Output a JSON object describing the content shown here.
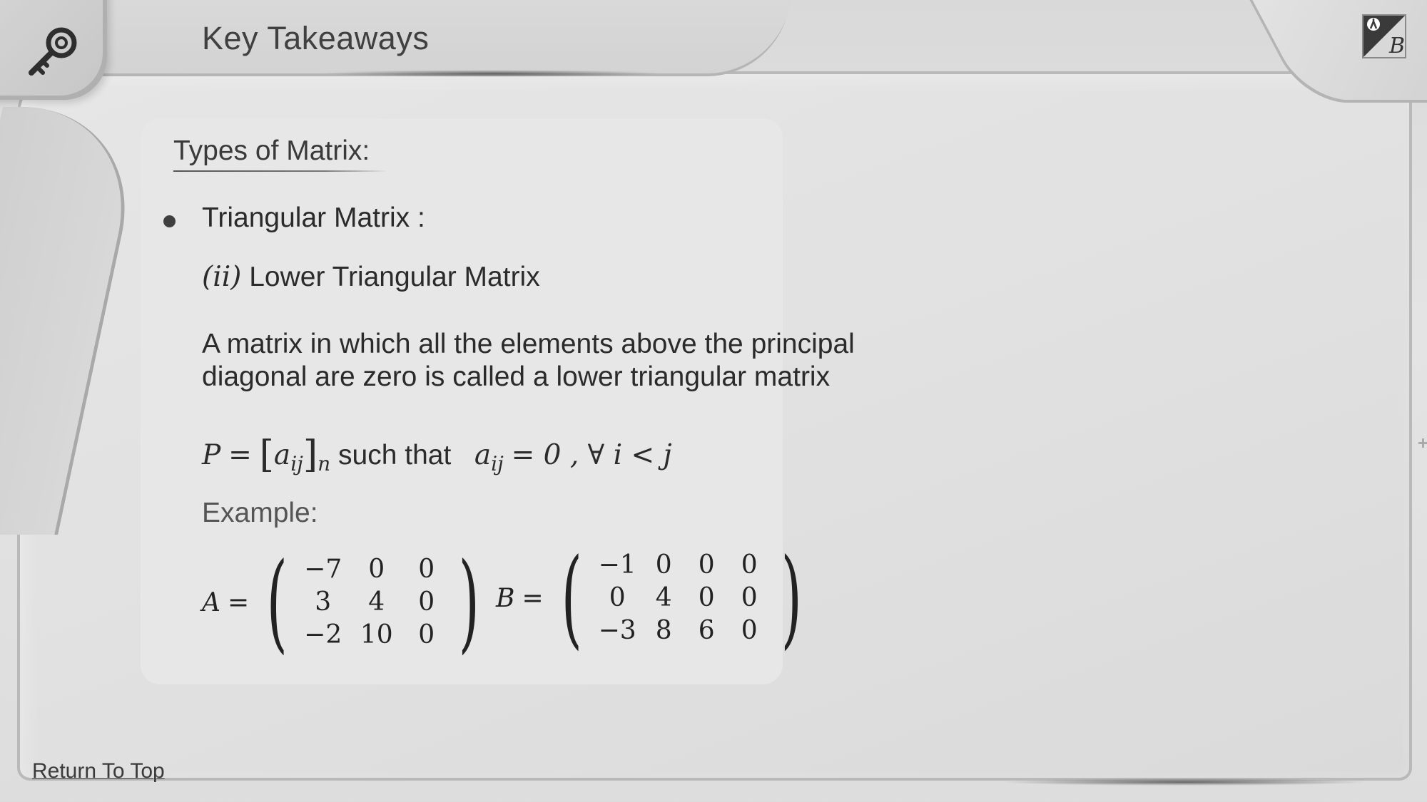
{
  "header": {
    "title": "Key Takeaways",
    "key_icon": "key-icon",
    "corner_icon": "bookmark-b-icon"
  },
  "content": {
    "section_title": "Types of Matrix:",
    "bullet_label": "Triangular Matrix :",
    "subhead_roman": "(ii)",
    "subhead_text": "Lower Triangular Matrix",
    "description_line1": "A matrix in which all the elements above the principal",
    "description_line2": "diagonal are zero is called a lower triangular matrix",
    "formula": {
      "lhs": "P",
      "eq": "=",
      "element": "a",
      "element_sub": "ij",
      "order_sub": "n",
      "connector": "such that",
      "condition_element": "a",
      "condition_sub": "ij",
      "condition_rest": "= 0 , ∀ i < j"
    },
    "example_label": "Example:",
    "matrix_a": {
      "name": "A",
      "rows": [
        [
          "−7",
          "0",
          "0"
        ],
        [
          "3",
          "4",
          "0"
        ],
        [
          "−2",
          "10",
          "0"
        ]
      ]
    },
    "matrix_b": {
      "name": "B",
      "rows": [
        [
          "−1",
          "0",
          "0",
          "0"
        ],
        [
          "0",
          "4",
          "0",
          "0"
        ],
        [
          "−3",
          "8",
          "6",
          "0"
        ]
      ]
    }
  },
  "footer": {
    "return_link": "Return To Top"
  }
}
